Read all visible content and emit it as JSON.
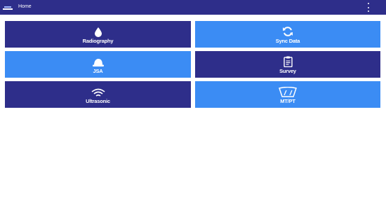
{
  "appbar": {
    "title": "Home",
    "menu_icon": "overflow-vertical-icon",
    "logo_icon": "app-logo-icon",
    "color": "#2e2e8a"
  },
  "tiles": [
    {
      "label": "Radiography",
      "icon": "water-drop-icon",
      "color": "#2e2e8a"
    },
    {
      "label": "Sync Data",
      "icon": "sync-icon",
      "color": "#3b8cf4"
    },
    {
      "label": "JSA",
      "icon": "hard-hat-icon",
      "color": "#3b8cf4"
    },
    {
      "label": "Survey",
      "icon": "clipboard-icon",
      "color": "#2e2e8a"
    },
    {
      "label": "Ultrasonic",
      "icon": "wifi-waves-icon",
      "color": "#2e2e8a"
    },
    {
      "label": "MT/PT",
      "icon": "windshield-icon",
      "color": "#3b8cf4"
    }
  ]
}
